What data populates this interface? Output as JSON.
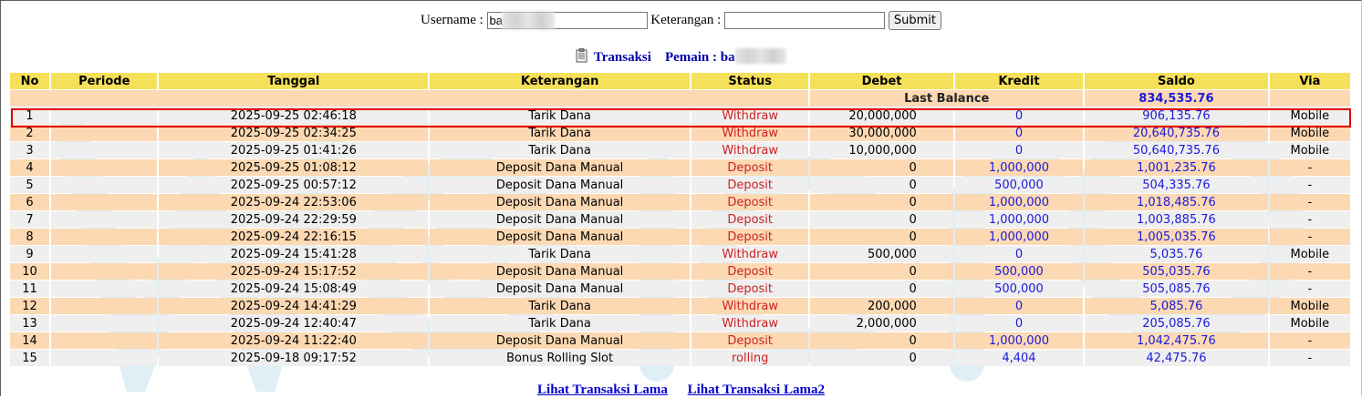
{
  "search": {
    "username_label": "Username :",
    "username_value": "ba",
    "keterangan_label": "Keterangan :",
    "keterangan_value": "",
    "submit_label": "Submit"
  },
  "title": {
    "transaksi_label": "Transaksi",
    "pemain_label": "Pemain : ba"
  },
  "table": {
    "headers": {
      "no": "No",
      "periode": "Periode",
      "tanggal": "Tanggal",
      "keterangan": "Keterangan",
      "status": "Status",
      "debet": "Debet",
      "kredit": "Kredit",
      "saldo": "Saldo",
      "via": "Via"
    },
    "last_balance_label": "Last Balance",
    "last_balance_value": "834,535.76",
    "rows": [
      {
        "no": "1",
        "periode": "",
        "tanggal": "2025-09-25 02:46:18",
        "keterangan": "Tarik Dana",
        "status": "Withdraw",
        "debet": "20,000,000",
        "kredit": "0",
        "saldo": "906,135.76",
        "via": "Mobile"
      },
      {
        "no": "2",
        "periode": "",
        "tanggal": "2025-09-25 02:34:25",
        "keterangan": "Tarik Dana",
        "status": "Withdraw",
        "debet": "30,000,000",
        "kredit": "0",
        "saldo": "20,640,735.76",
        "via": "Mobile"
      },
      {
        "no": "3",
        "periode": "",
        "tanggal": "2025-09-25 01:41:26",
        "keterangan": "Tarik Dana",
        "status": "Withdraw",
        "debet": "10,000,000",
        "kredit": "0",
        "saldo": "50,640,735.76",
        "via": "Mobile"
      },
      {
        "no": "4",
        "periode": "",
        "tanggal": "2025-09-25 01:08:12",
        "keterangan": "Deposit Dana Manual",
        "status": "Deposit",
        "debet": "0",
        "kredit": "1,000,000",
        "saldo": "1,001,235.76",
        "via": "-"
      },
      {
        "no": "5",
        "periode": "",
        "tanggal": "2025-09-25 00:57:12",
        "keterangan": "Deposit Dana Manual",
        "status": "Deposit",
        "debet": "0",
        "kredit": "500,000",
        "saldo": "504,335.76",
        "via": "-"
      },
      {
        "no": "6",
        "periode": "",
        "tanggal": "2025-09-24 22:53:06",
        "keterangan": "Deposit Dana Manual",
        "status": "Deposit",
        "debet": "0",
        "kredit": "1,000,000",
        "saldo": "1,018,485.76",
        "via": "-"
      },
      {
        "no": "7",
        "periode": "",
        "tanggal": "2025-09-24 22:29:59",
        "keterangan": "Deposit Dana Manual",
        "status": "Deposit",
        "debet": "0",
        "kredit": "1,000,000",
        "saldo": "1,003,885.76",
        "via": "-"
      },
      {
        "no": "8",
        "periode": "",
        "tanggal": "2025-09-24 22:16:15",
        "keterangan": "Deposit Dana Manual",
        "status": "Deposit",
        "debet": "0",
        "kredit": "1,000,000",
        "saldo": "1,005,035.76",
        "via": "-"
      },
      {
        "no": "9",
        "periode": "",
        "tanggal": "2025-09-24 15:41:28",
        "keterangan": "Tarik Dana",
        "status": "Withdraw",
        "debet": "500,000",
        "kredit": "0",
        "saldo": "5,035.76",
        "via": "Mobile"
      },
      {
        "no": "10",
        "periode": "",
        "tanggal": "2025-09-24 15:17:52",
        "keterangan": "Deposit Dana Manual",
        "status": "Deposit",
        "debet": "0",
        "kredit": "500,000",
        "saldo": "505,035.76",
        "via": "-"
      },
      {
        "no": "11",
        "periode": "",
        "tanggal": "2025-09-24 15:08:49",
        "keterangan": "Deposit Dana Manual",
        "status": "Deposit",
        "debet": "0",
        "kredit": "500,000",
        "saldo": "505,085.76",
        "via": "-"
      },
      {
        "no": "12",
        "periode": "",
        "tanggal": "2025-09-24 14:41:29",
        "keterangan": "Tarik Dana",
        "status": "Withdraw",
        "debet": "200,000",
        "kredit": "0",
        "saldo": "5,085.76",
        "via": "Mobile"
      },
      {
        "no": "13",
        "periode": "",
        "tanggal": "2025-09-24 12:40:47",
        "keterangan": "Tarik Dana",
        "status": "Withdraw",
        "debet": "2,000,000",
        "kredit": "0",
        "saldo": "205,085.76",
        "via": "Mobile"
      },
      {
        "no": "14",
        "periode": "",
        "tanggal": "2025-09-24 11:22:40",
        "keterangan": "Deposit Dana Manual",
        "status": "Deposit",
        "debet": "0",
        "kredit": "1,000,000",
        "saldo": "1,042,475.76",
        "via": "-"
      },
      {
        "no": "15",
        "periode": "",
        "tanggal": "2025-09-18 09:17:52",
        "keterangan": "Bonus Rolling Slot",
        "status": "rolling",
        "debet": "0",
        "kredit": "4,404",
        "saldo": "42,475.76",
        "via": "-"
      }
    ]
  },
  "links": {
    "old_transactions": "Lihat Transaksi Lama",
    "old_transactions_2": "Lihat Transaksi Lama2"
  },
  "colors": {
    "header_bg": "#f5e05a",
    "row_odd_bg": "#fcd9b3",
    "row_even_bg": "#efefef",
    "status_red": "#cc2222",
    "number_blue": "#1a1adc",
    "highlight_red": "#e00000"
  },
  "icons": {
    "title_icon": "document-icon"
  }
}
